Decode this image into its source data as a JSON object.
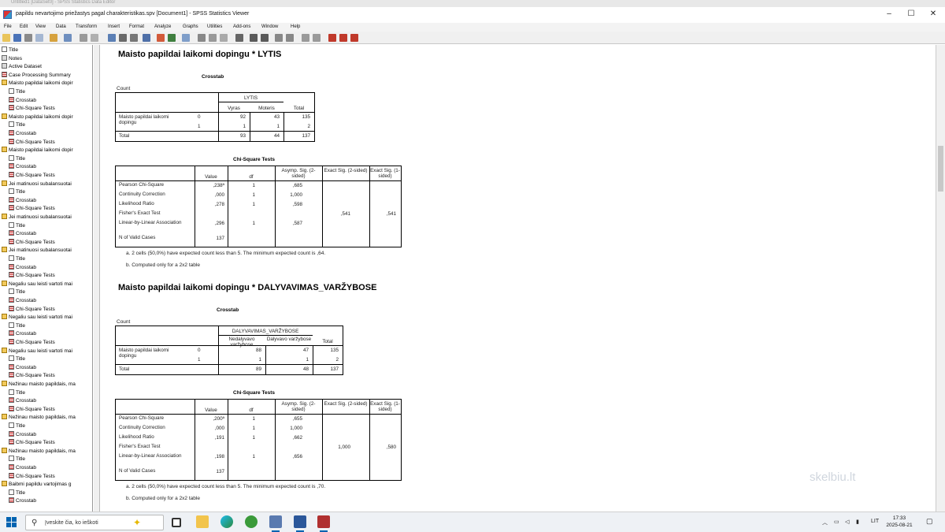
{
  "titlebar": {
    "ghost_title": "Untitled1 [DataSet0] - SPSS Statistics Data Editor",
    "window_title": "papildu nevartojimo priežastys pagal charakteristikas.spv [Document1] - SPSS Statistics Viewer",
    "minimize": "–",
    "maximize": "☐",
    "close": "✕"
  },
  "menu": [
    "File",
    "Edit",
    "View",
    "Data",
    "Transform",
    "Insert",
    "Format",
    "Analyze",
    "Graphs",
    "Utilities",
    "Add-ons",
    "Window",
    "Help"
  ],
  "nav": [
    {
      "label": "Title",
      "icon": "t",
      "indent": 0
    },
    {
      "label": "Notes",
      "icon": "g",
      "indent": 0
    },
    {
      "label": "Active Dataset",
      "icon": "g",
      "indent": 0
    },
    {
      "label": "Case Processing Summary",
      "icon": "ct",
      "indent": 0
    },
    {
      "label": "Maisto papildai laikomi dopir",
      "icon": "fold",
      "indent": 0
    },
    {
      "label": "Title",
      "icon": "t",
      "indent": 1
    },
    {
      "label": "Crosstab",
      "icon": "ct",
      "indent": 1
    },
    {
      "label": "Chi-Square Tests",
      "icon": "ct",
      "indent": 1
    },
    {
      "label": "Maisto papildai laikomi dopir",
      "icon": "fold",
      "indent": 0
    },
    {
      "label": "Title",
      "icon": "t",
      "indent": 1
    },
    {
      "label": "Crosstab",
      "icon": "ct",
      "indent": 1
    },
    {
      "label": "Chi-Square Tests",
      "icon": "ct",
      "indent": 1
    },
    {
      "label": "Maisto papildai laikomi dopir",
      "icon": "fold",
      "indent": 0
    },
    {
      "label": "Title",
      "icon": "t",
      "indent": 1
    },
    {
      "label": "Crosstab",
      "icon": "ct",
      "indent": 1
    },
    {
      "label": "Chi-Square Tests",
      "icon": "ct",
      "indent": 1
    },
    {
      "label": "Jei matinuosi subalansuotai",
      "icon": "fold",
      "indent": 0
    },
    {
      "label": "Title",
      "icon": "t",
      "indent": 1
    },
    {
      "label": "Crosstab",
      "icon": "ct",
      "indent": 1
    },
    {
      "label": "Chi-Square Tests",
      "icon": "ct",
      "indent": 1
    },
    {
      "label": "Jei matinuosi subalansuotai",
      "icon": "fold",
      "indent": 0
    },
    {
      "label": "Title",
      "icon": "t",
      "indent": 1
    },
    {
      "label": "Crosstab",
      "icon": "ct",
      "indent": 1
    },
    {
      "label": "Chi-Square Tests",
      "icon": "ct",
      "indent": 1
    },
    {
      "label": "Jei matinuosi subalansuotai",
      "icon": "fold",
      "indent": 0
    },
    {
      "label": "Title",
      "icon": "t",
      "indent": 1
    },
    {
      "label": "Crosstab",
      "icon": "ct",
      "indent": 1
    },
    {
      "label": "Chi-Square Tests",
      "icon": "ct",
      "indent": 1
    },
    {
      "label": "Negaliu sau leisti vartoti mai",
      "icon": "fold",
      "indent": 0
    },
    {
      "label": "Title",
      "icon": "t",
      "indent": 1
    },
    {
      "label": "Crosstab",
      "icon": "ct",
      "indent": 1
    },
    {
      "label": "Chi-Square Tests",
      "icon": "ct",
      "indent": 1
    },
    {
      "label": "Negaliu sau leisti vartoti mai",
      "icon": "fold",
      "indent": 0
    },
    {
      "label": "Title",
      "icon": "t",
      "indent": 1
    },
    {
      "label": "Crosstab",
      "icon": "ct",
      "indent": 1
    },
    {
      "label": "Chi-Square Tests",
      "icon": "ct",
      "indent": 1
    },
    {
      "label": "Negaliu sau leisti vartoti mai",
      "icon": "fold",
      "indent": 0
    },
    {
      "label": "Title",
      "icon": "t",
      "indent": 1
    },
    {
      "label": "Crosstab",
      "icon": "ct",
      "indent": 1
    },
    {
      "label": "Chi-Square Tests",
      "icon": "ct",
      "indent": 1
    },
    {
      "label": "Nežinau maisto papildais, ma",
      "icon": "fold",
      "indent": 0
    },
    {
      "label": "Title",
      "icon": "t",
      "indent": 1
    },
    {
      "label": "Crosstab",
      "icon": "ct",
      "indent": 1
    },
    {
      "label": "Chi-Square Tests",
      "icon": "ct",
      "indent": 1
    },
    {
      "label": "Nežinau maisto papildais, ma",
      "icon": "fold",
      "indent": 0
    },
    {
      "label": "Title",
      "icon": "t",
      "indent": 1
    },
    {
      "label": "Crosstab",
      "icon": "ct",
      "indent": 1
    },
    {
      "label": "Chi-Square Tests",
      "icon": "ct",
      "indent": 1
    },
    {
      "label": "Nežinau maisto papildais, ma",
      "icon": "fold",
      "indent": 0
    },
    {
      "label": "Title",
      "icon": "t",
      "indent": 1
    },
    {
      "label": "Crosstab",
      "icon": "ct",
      "indent": 1
    },
    {
      "label": "Chi-Square Tests",
      "icon": "ct",
      "indent": 1
    },
    {
      "label": "Baibmi papildu vartojimas g",
      "icon": "fold",
      "indent": 0
    },
    {
      "label": "Title",
      "icon": "t",
      "indent": 1
    },
    {
      "label": "Crosstab",
      "icon": "ct",
      "indent": 1
    }
  ],
  "sections": [
    {
      "heading": "Maisto papildai laikomi dopingu * LYTIS",
      "crosstab": {
        "caption": "Crosstab",
        "count_label": "Count",
        "var_header": "LYTIS",
        "col1": "Vyras",
        "col2": "Moteris",
        "total_col": "Total",
        "row_var": "Maisto papildai laikomi dopingu",
        "rows": [
          {
            "code": "0",
            "a": "92",
            "b": "43",
            "t": "135"
          },
          {
            "code": "1",
            "a": "1",
            "b": "1",
            "t": "2"
          }
        ],
        "total_row": {
          "label": "Total",
          "a": "93",
          "b": "44",
          "t": "137"
        }
      },
      "chisq": {
        "caption": "Chi-Square Tests",
        "headers": [
          "Value",
          "df",
          "Asymp. Sig. (2-sided)",
          "Exact Sig. (2-sided)",
          "Exact Sig. (1-sided)"
        ],
        "rows": [
          {
            "name": "Pearson Chi-Square",
            "v": ",238ª",
            "df": "1",
            "as": ",685",
            "e2": "",
            "e1": ""
          },
          {
            "name": "Continuity Correction",
            "v": ",000",
            "df": "1",
            "as": "1,000",
            "e2": "",
            "e1": ""
          },
          {
            "name": "Likelihood Ratio",
            "v": ",278",
            "df": "1",
            "as": ",598",
            "e2": "",
            "e1": ""
          },
          {
            "name": "Fisher's Exact Test",
            "v": "",
            "df": "",
            "as": "",
            "e2": ",541",
            "e1": ",541"
          },
          {
            "name": "Linear-by-Linear Association",
            "v": ",296",
            "df": "1",
            "as": ",587",
            "e2": "",
            "e1": ""
          },
          {
            "name": "N of Valid Cases",
            "v": "137",
            "df": "",
            "as": "",
            "e2": "",
            "e1": ""
          }
        ],
        "foot_a": "a. 2 cells (50,0%) have expected count less than 5. The minimum expected count is ,64.",
        "foot_b": "b. Computed only for a 2x2 table"
      }
    },
    {
      "heading": "Maisto papildai laikomi dopingu * DALYVAVIMAS_VARŽYBOSE",
      "crosstab": {
        "caption": "Crosstab",
        "count_label": "Count",
        "var_header": "DALYVAVIMAS_VARŽYBOSE",
        "col1": "Nedalyvavo varžybose",
        "col2": "Dalyvavo varžybose",
        "total_col": "Total",
        "row_var": "Maisto papildai laikomi dopingu",
        "rows": [
          {
            "code": "0",
            "a": "88",
            "b": "47",
            "t": "135"
          },
          {
            "code": "1",
            "a": "1",
            "b": "1",
            "t": "2"
          }
        ],
        "total_row": {
          "label": "Total",
          "a": "89",
          "b": "48",
          "t": "137"
        }
      },
      "chisq": {
        "caption": "Chi-Square Tests",
        "headers": [
          "Value",
          "df",
          "Asymp. Sig. (2-sided)",
          "Exact Sig. (2-sided)",
          "Exact Sig. (1-sided)"
        ],
        "rows": [
          {
            "name": "Pearson Chi-Square",
            "v": ",200ª",
            "df": "1",
            "as": ",655",
            "e2": "",
            "e1": ""
          },
          {
            "name": "Continuity Correction",
            "v": ",000",
            "df": "1",
            "as": "1,000",
            "e2": "",
            "e1": ""
          },
          {
            "name": "Likelihood Ratio",
            "v": ",191",
            "df": "1",
            "as": ",662",
            "e2": "",
            "e1": ""
          },
          {
            "name": "Fisher's Exact Test",
            "v": "",
            "df": "",
            "as": "",
            "e2": "1,000",
            "e1": ",580"
          },
          {
            "name": "Linear-by-Linear Association",
            "v": ",198",
            "df": "1",
            "as": ",656",
            "e2": "",
            "e1": ""
          },
          {
            "name": "N of Valid Cases",
            "v": "137",
            "df": "",
            "as": "",
            "e2": "",
            "e1": ""
          }
        ],
        "foot_a": "a. 2 cells (50,0%) have expected count less than 5. The minimum expected count is ,70.",
        "foot_b": "b. Computed only for a 2x2 table"
      }
    }
  ],
  "watermark": "skelbiu.lt",
  "taskbar": {
    "search_placeholder": "Įveskite čia, ko ieškoti",
    "lang": "LIT",
    "time": "17:33",
    "date": "2025-08-21"
  }
}
